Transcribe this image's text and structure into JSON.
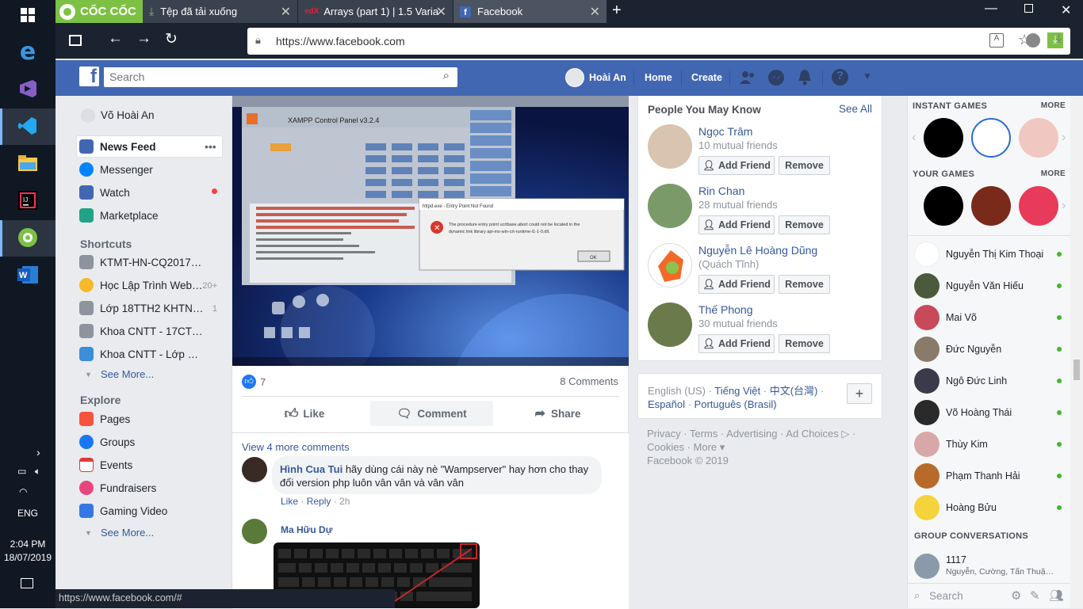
{
  "browser": {
    "brand": "CỐC CỐC",
    "tabs": [
      {
        "label": "Tệp đã tải xuống"
      },
      {
        "label": "Arrays (part 1) | 1.5 Variab"
      },
      {
        "label": "Facebook"
      }
    ],
    "url": "https://www.facebook.com",
    "status_url": "https://www.facebook.com/#"
  },
  "taskbar": {
    "lang": "ENG",
    "time": "2:04 PM",
    "date": "18/07/2019"
  },
  "fb": {
    "search_placeholder": "Search",
    "profile_name": "Hoài An",
    "home": "Home",
    "create": "Create"
  },
  "left": {
    "user": "Võ Hoài An",
    "main": [
      {
        "label": "News Feed"
      },
      {
        "label": "Messenger"
      },
      {
        "label": "Watch"
      },
      {
        "label": "Marketplace"
      }
    ],
    "shortcuts_title": "Shortcuts",
    "shortcuts": [
      {
        "label": "KTMT-HN-CQ2017…",
        "count": ""
      },
      {
        "label": "Học Lập Trình Web…",
        "count": "20+"
      },
      {
        "label": "Lớp 18TTH2 KHTN…",
        "count": "1"
      },
      {
        "label": "Khoa CNTT - 17CT…",
        "count": ""
      },
      {
        "label": "Khoa CNTT - Lớp …",
        "count": ""
      }
    ],
    "see_more": "See More...",
    "explore_title": "Explore",
    "explore": [
      {
        "label": "Pages"
      },
      {
        "label": "Groups"
      },
      {
        "label": "Events"
      },
      {
        "label": "Fundraisers"
      },
      {
        "label": "Gaming Video"
      }
    ],
    "see_more2": "See More..."
  },
  "post": {
    "likes": "7",
    "comments_count": "8 Comments",
    "like": "Like",
    "comment": "Comment",
    "share": "Share",
    "view_more": "View 4 more comments",
    "c1_author": "Hình Cua Tui",
    "c1_text": "hãy dùng cái này nè \"Wampserver\" hay hơn cho thay đổi version php luôn vân vân và vân vân",
    "c1_like": "Like",
    "c1_reply": "Reply",
    "c1_time": "2h",
    "c2_author": "Ma Hữu Dự",
    "screenshot": {
      "title": "XAMPP Control Panel v3.2.4",
      "dialog_title": "httpd.exe - Entry Point Not Found",
      "dialog_text": "The procedure entry point ucrtbase.abort could not be located in the dynamic link library api-ms-win-crt-runtime-l1-1-0.dll.",
      "ok": "OK"
    }
  },
  "pymk": {
    "title": "People You May Know",
    "see_all": "See All",
    "add": "Add Friend",
    "remove": "Remove",
    "people": [
      {
        "name": "Ngọc Trâm",
        "sub": "10 mutual friends"
      },
      {
        "name": "Rin Chan",
        "sub": "28 mutual friends"
      },
      {
        "name": "Nguyễn Lê Hoàng Dũng",
        "sub": "(Quách Tĩnh)"
      },
      {
        "name": "Thế Phong",
        "sub": "30 mutual friends"
      }
    ]
  },
  "lang": {
    "line1a": "English (US)",
    "line1b": "Tiếng Việt",
    "line1c": "中文(台灣)",
    "line2a": "Español",
    "line2b": "Português (Brasil)"
  },
  "footer": {
    "l1": "Privacy · Terms · Advertising · Ad Choices ▷ ·",
    "l2": "Cookies · More ▾",
    "l3": "Facebook © 2019"
  },
  "chat": {
    "instant_games": "INSTANT GAMES",
    "your_games": "YOUR GAMES",
    "more": "MORE",
    "people": [
      {
        "name": "Nguyễn Thị Kim Thoại"
      },
      {
        "name": "Nguyễn Văn Hiếu"
      },
      {
        "name": "Mai Võ"
      },
      {
        "name": "Đức Nguyễn"
      },
      {
        "name": "Ngô Đức Linh"
      },
      {
        "name": "Võ Hoàng Thái"
      },
      {
        "name": "Thùy Kim"
      },
      {
        "name": "Phạm Thanh Hải"
      },
      {
        "name": "Hoàng Bửu"
      }
    ],
    "group_title": "GROUP CONVERSATIONS",
    "group_name": "1117",
    "group_members": "Nguyễn, Cường, Tấn Thuậ…",
    "search": "Search"
  }
}
